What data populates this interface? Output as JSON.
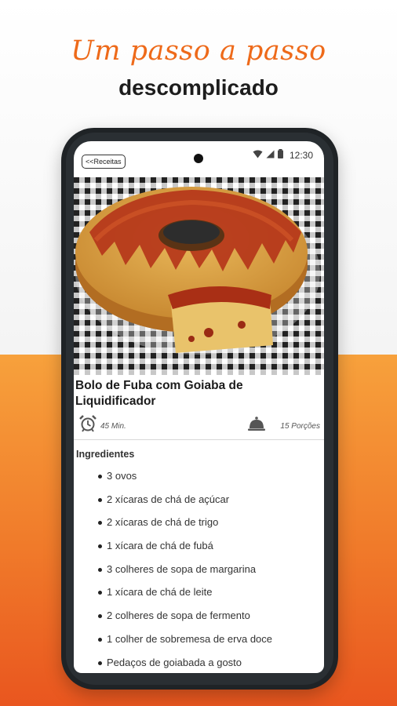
{
  "headline": "Um passo a passo",
  "subhead": "descomplicado",
  "status": {
    "time": "12:30"
  },
  "back_button": {
    "label": "<<Receitas"
  },
  "recipe": {
    "title": " Bolo de Fuba com Goiaba de Liquidificador",
    "time": "45 Min.",
    "servings": "15 Porções",
    "ingredients_heading": "Ingredientes",
    "ingredients": [
      "3 ovos",
      "2 xícaras de chá de açúcar",
      "2 xícaras de chá de trigo",
      "1 xícara de chá de fubá",
      "3 colheres de sopa de margarina",
      "1 xícara de chá de leite",
      "2 colheres de sopa de fermento",
      "1 colher de sobremesa de erva doce",
      "Pedaços de goiabada a gosto"
    ]
  },
  "colors": {
    "accent": "#ee6a1a",
    "gradient_top": "#f7a13c",
    "gradient_bottom": "#e9561f"
  }
}
